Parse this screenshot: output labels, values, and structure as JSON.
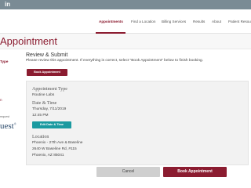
{
  "topbar": {
    "social": "in"
  },
  "nav": {
    "tabs": [
      {
        "label": "Appointments"
      },
      {
        "label": "Find a Location"
      },
      {
        "label": "Billing Services"
      },
      {
        "label": "Results"
      },
      {
        "label": "About"
      },
      {
        "label": "Patient Resou"
      }
    ],
    "active_tab": "Appointments"
  },
  "page": {
    "title": "Appointment"
  },
  "sidebar": {
    "item_type": "Type",
    "item_current": "n",
    "note": "request",
    "logo_text": "uest"
  },
  "review": {
    "heading": "Review & Submit",
    "instructions": "Please review this appointment. If everything is correct, select \"Book Appointment\" below to finish booking.",
    "book_top_label": "Book Appointment"
  },
  "details": {
    "type_label": "Appointment Type",
    "type_value": "Routine Labs",
    "datetime_label": "Date & Time",
    "date_value": "Thursday, 7/11/2019",
    "time_value": "12:45 PM",
    "edit_button": "Edit Date & Time",
    "location_label": "Location",
    "location_name": "Phoenix - 27th Ave & Baseline",
    "location_address": "2640 W Baseline Rd, #115",
    "location_city": "Phoenix, AZ 85041"
  },
  "actions": {
    "cancel": "Cancel",
    "book": "Book Appointment"
  },
  "colors": {
    "brand": "#8b1c30",
    "teal": "#1a9aa0",
    "topbar": "#7a8b95"
  }
}
